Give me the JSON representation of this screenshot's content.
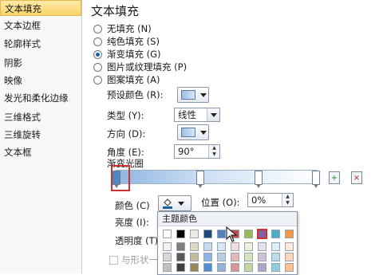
{
  "nav": {
    "items": [
      {
        "label": "文本填充",
        "selected": true
      },
      {
        "label": "文本边框",
        "selected": false
      },
      {
        "label": "轮廓样式",
        "selected": false
      },
      {
        "label": "阴影",
        "selected": false
      },
      {
        "label": "映像",
        "selected": false
      },
      {
        "label": "发光和柔化边缘",
        "selected": false
      },
      {
        "label": "三维格式",
        "selected": false
      },
      {
        "label": "三维旋转",
        "selected": false
      },
      {
        "label": "文本框",
        "selected": false
      }
    ]
  },
  "main": {
    "title": "文本填充",
    "fill_options": [
      {
        "label": "无填充 (N)",
        "checked": false
      },
      {
        "label": "纯色填充 (S)",
        "checked": false
      },
      {
        "label": "渐变填充 (G)",
        "checked": true
      },
      {
        "label": "图片或纹理填充 (P)",
        "checked": false
      },
      {
        "label": "图案填充 (A)",
        "checked": false
      }
    ],
    "preset_label": "预设颜色 (R):",
    "type_label": "类型 (Y):",
    "type_value": "线性",
    "direction_label": "方向 (D):",
    "angle_label": "角度 (E):",
    "angle_value": "90°",
    "stops_label": "渐变光圈",
    "stop_positions": [
      0.0,
      0.42,
      0.71,
      1.0
    ],
    "color_label": "颜色 (C)",
    "position_label": "位置 (O):",
    "position_value": "0%",
    "brightness_label": "亮度 (I):",
    "transparency_label": "透明度 (T)",
    "rotate_with_shape_label": "与形状一"
  },
  "color_popup": {
    "title": "主题颜色",
    "theme_row": [
      "#ffffff",
      "#000000",
      "#eeece1",
      "#1f497d",
      "#4f81bd",
      "#c0504d",
      "#9bbb59",
      "#8064a2",
      "#4bacc6",
      "#f79646"
    ],
    "shade_rows": [
      [
        "#f2f2f2",
        "#7f7f7f",
        "#ddd9c3",
        "#c6d9f0",
        "#dbe5f1",
        "#f2dcdb",
        "#ebf1dd",
        "#e5e0ec",
        "#dbeef3",
        "#fdeada"
      ],
      [
        "#d8d8d8",
        "#595959",
        "#c4bd97",
        "#8db3e2",
        "#b8cce4",
        "#e5b9b7",
        "#d7e3bc",
        "#ccc1d9",
        "#b7dde8",
        "#fbd5b5"
      ],
      [
        "#bfbfbf",
        "#3f3f3f",
        "#938953",
        "#548dd4",
        "#95b3d7",
        "#d99694",
        "#c3d69b",
        "#b2a2c7",
        "#92cddc",
        "#fac08f"
      ]
    ],
    "selected_index": 7
  }
}
